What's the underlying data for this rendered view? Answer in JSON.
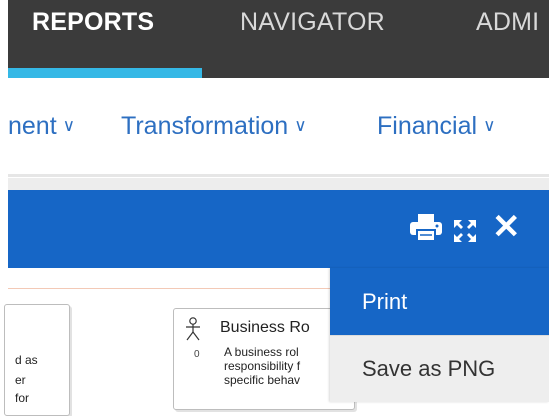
{
  "topnav": {
    "tabs": [
      {
        "label": "REPORTS",
        "active": true
      },
      {
        "label": "NAVIGATOR",
        "active": false
      },
      {
        "label": "ADMI",
        "active": false
      }
    ],
    "active_color": "#35b8e6"
  },
  "subnav": {
    "items": [
      {
        "label": "nent"
      },
      {
        "label": "Transformation"
      },
      {
        "label": "Financial"
      }
    ],
    "chevron": "∨"
  },
  "panel": {
    "color": "#1666c6",
    "icons": [
      "print-icon",
      "expand-icon",
      "close-icon"
    ],
    "close_glyph": "✕"
  },
  "diagram": {
    "left_box": {
      "lines": [
        "d as",
        "er",
        "for"
      ]
    },
    "right_box": {
      "title": "Business Ro",
      "count": "0",
      "desc_lines": [
        "A business rol",
        "responsibility f",
        "specific behav"
      ]
    }
  },
  "menu": {
    "options": [
      {
        "label": "Print",
        "selected": true
      },
      {
        "label": "Save as PNG",
        "selected": false
      }
    ]
  }
}
